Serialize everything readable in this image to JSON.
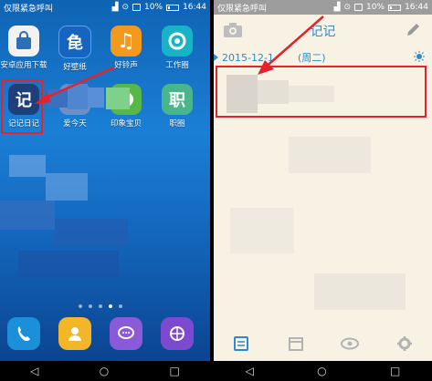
{
  "status_bar": {
    "carrier": "仅限紧急呼叫",
    "battery": "10%",
    "time": "16:44"
  },
  "home": {
    "apps_row1": [
      {
        "label": "安卓应用下载",
        "icon": "shopping-bag-icon",
        "color": "#f2f2f2"
      },
      {
        "label": "好壁纸",
        "icon": "wallpaper-icon",
        "glyph": "㲋",
        "color": "#1565c0"
      },
      {
        "label": "好铃声",
        "icon": "music-note-icon",
        "glyph": "♫",
        "color": "#f39a1e"
      },
      {
        "label": "工作圈",
        "icon": "work-circle-icon",
        "color": "#19b3c7"
      }
    ],
    "apps_row2": [
      {
        "label": "记记日记",
        "icon": "diary-icon",
        "glyph": "记",
        "color": "#1e3f7a"
      },
      {
        "label": "爱今天",
        "icon": "love-today-icon",
        "color": "#6c8fc5"
      },
      {
        "label": "印象宝贝",
        "icon": "baby-icon",
        "color": "#57b848"
      },
      {
        "label": "职圈",
        "icon": "job-circle-icon",
        "glyph": "职",
        "color": "#49b58c"
      }
    ],
    "dock": [
      {
        "name": "phone",
        "icon": "phone-icon",
        "color": "#1b8fd8"
      },
      {
        "name": "contacts",
        "icon": "contacts-icon",
        "color": "#f3b628"
      },
      {
        "name": "messages",
        "icon": "message-icon",
        "color": "#8a5ad8"
      },
      {
        "name": "browser",
        "icon": "browser-icon",
        "color": "#7b4ad0"
      }
    ]
  },
  "diary": {
    "title": "记记",
    "date_label": "2015-12-1",
    "weekday_label": "(周二)"
  },
  "colors": {
    "accent": "#2d8ad1",
    "highlight": "#e4232b"
  }
}
